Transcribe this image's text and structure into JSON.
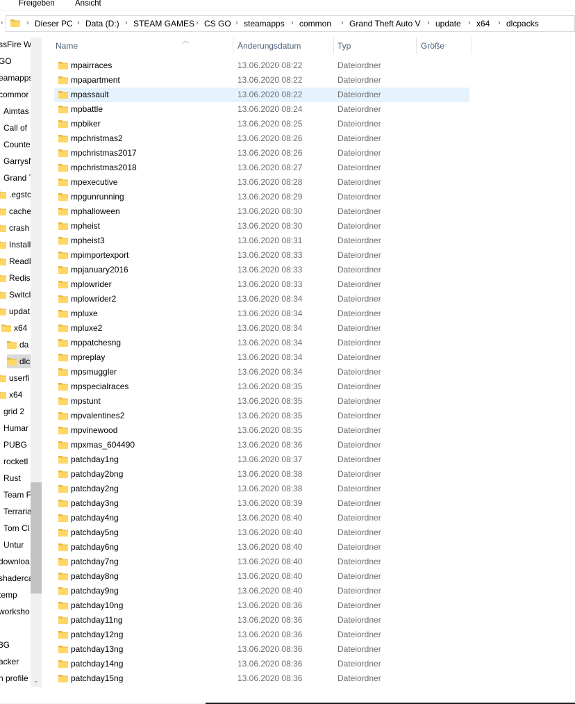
{
  "ribbon": {
    "tabs": [
      "Freigeben",
      "Ansicht"
    ]
  },
  "address_bar": {
    "icon": "folder-icon",
    "crumbs": [
      "Dieser PC",
      "Data (D:)",
      "STEAM GAMES",
      "CS GO",
      "steamapps",
      "common",
      "Grand Theft Auto V",
      "update",
      "x64",
      "dlcpacks"
    ]
  },
  "nav_pane": {
    "items": [
      {
        "label": "ssFire W",
        "folder": false
      },
      {
        "label": "GO",
        "folder": false
      },
      {
        "label": "eamapps",
        "folder": false
      },
      {
        "label": "commor",
        "folder": false
      },
      {
        "label": "Aimtas",
        "folder": false
      },
      {
        "label": "Call of",
        "folder": false
      },
      {
        "label": "Counte",
        "folder": false
      },
      {
        "label": "GarrysN",
        "folder": false
      },
      {
        "label": "Grand T",
        "folder": false
      },
      {
        "label": ".egstc",
        "folder": true
      },
      {
        "label": "cache",
        "folder": true
      },
      {
        "label": "crash",
        "folder": true
      },
      {
        "label": "Install",
        "folder": true
      },
      {
        "label": "ReadM",
        "folder": true
      },
      {
        "label": "Redist",
        "folder": true
      },
      {
        "label": "Switcl",
        "folder": true
      },
      {
        "label": "updat",
        "folder": true
      },
      {
        "label": "x64",
        "folder": true
      },
      {
        "label": "da",
        "folder": true
      },
      {
        "label": "dlc",
        "folder": true,
        "selected": true
      },
      {
        "label": "userfi",
        "folder": true
      },
      {
        "label": "x64",
        "folder": true
      },
      {
        "label": "grid 2",
        "folder": false
      },
      {
        "label": "Humar",
        "folder": false
      },
      {
        "label": "PUBG",
        "folder": false
      },
      {
        "label": "rocketl",
        "folder": false
      },
      {
        "label": "Rust",
        "folder": false
      },
      {
        "label": "Team F",
        "folder": false
      },
      {
        "label": "Terraria",
        "folder": false
      },
      {
        "label": "Tom Cl",
        "folder": false
      },
      {
        "label": "Untur",
        "folder": false
      },
      {
        "label": "downloa",
        "folder": false
      },
      {
        "label": "shaderca",
        "folder": false
      },
      {
        "label": "temp",
        "folder": false
      },
      {
        "label": "worksho",
        "folder": false
      },
      {
        "label": "",
        "folder": false
      },
      {
        "label": "3G",
        "folder": false
      },
      {
        "label": "acker",
        "folder": false
      },
      {
        "label": "n profile",
        "folder": false
      }
    ]
  },
  "columns": {
    "name": "Name",
    "date": "Änderungsdatum",
    "type": "Typ",
    "size": "Größe"
  },
  "files": [
    {
      "name": "mpairraces",
      "date": "13.06.2020 08:22",
      "type": "Dateiordner"
    },
    {
      "name": "mpapartment",
      "date": "13.06.2020 08:22",
      "type": "Dateiordner"
    },
    {
      "name": "mpassault",
      "date": "13.06.2020 08:22",
      "type": "Dateiordner",
      "hover": true
    },
    {
      "name": "mpbattle",
      "date": "13.06.2020 08:24",
      "type": "Dateiordner"
    },
    {
      "name": "mpbiker",
      "date": "13.06.2020 08:25",
      "type": "Dateiordner"
    },
    {
      "name": "mpchristmas2",
      "date": "13.06.2020 08:26",
      "type": "Dateiordner"
    },
    {
      "name": "mpchristmas2017",
      "date": "13.06.2020 08:26",
      "type": "Dateiordner"
    },
    {
      "name": "mpchristmas2018",
      "date": "13.06.2020 08:27",
      "type": "Dateiordner"
    },
    {
      "name": "mpexecutive",
      "date": "13.06.2020 08:28",
      "type": "Dateiordner"
    },
    {
      "name": "mpgunrunning",
      "date": "13.06.2020 08:29",
      "type": "Dateiordner"
    },
    {
      "name": "mphalloween",
      "date": "13.06.2020 08:30",
      "type": "Dateiordner"
    },
    {
      "name": "mpheist",
      "date": "13.06.2020 08:30",
      "type": "Dateiordner"
    },
    {
      "name": "mpheist3",
      "date": "13.06.2020 08:31",
      "type": "Dateiordner"
    },
    {
      "name": "mpimportexport",
      "date": "13.06.2020 08:33",
      "type": "Dateiordner"
    },
    {
      "name": "mpjanuary2016",
      "date": "13.06.2020 08:33",
      "type": "Dateiordner"
    },
    {
      "name": "mplowrider",
      "date": "13.06.2020 08:33",
      "type": "Dateiordner"
    },
    {
      "name": "mplowrider2",
      "date": "13.06.2020 08:34",
      "type": "Dateiordner"
    },
    {
      "name": "mpluxe",
      "date": "13.06.2020 08:34",
      "type": "Dateiordner"
    },
    {
      "name": "mpluxe2",
      "date": "13.06.2020 08:34",
      "type": "Dateiordner"
    },
    {
      "name": "mppatchesng",
      "date": "13.06.2020 08:34",
      "type": "Dateiordner"
    },
    {
      "name": "mpreplay",
      "date": "13.06.2020 08:34",
      "type": "Dateiordner"
    },
    {
      "name": "mpsmuggler",
      "date": "13.06.2020 08:34",
      "type": "Dateiordner"
    },
    {
      "name": "mpspecialraces",
      "date": "13.06.2020 08:35",
      "type": "Dateiordner"
    },
    {
      "name": "mpstunt",
      "date": "13.06.2020 08:35",
      "type": "Dateiordner"
    },
    {
      "name": "mpvalentines2",
      "date": "13.06.2020 08:35",
      "type": "Dateiordner"
    },
    {
      "name": "mpvinewood",
      "date": "13.06.2020 08:35",
      "type": "Dateiordner"
    },
    {
      "name": "mpxmas_604490",
      "date": "13.06.2020 08:36",
      "type": "Dateiordner"
    },
    {
      "name": "patchday1ng",
      "date": "13.06.2020 08:37",
      "type": "Dateiordner"
    },
    {
      "name": "patchday2bng",
      "date": "13.06.2020 08:38",
      "type": "Dateiordner"
    },
    {
      "name": "patchday2ng",
      "date": "13.06.2020 08:38",
      "type": "Dateiordner"
    },
    {
      "name": "patchday3ng",
      "date": "13.06.2020 08:39",
      "type": "Dateiordner"
    },
    {
      "name": "patchday4ng",
      "date": "13.06.2020 08:40",
      "type": "Dateiordner"
    },
    {
      "name": "patchday5ng",
      "date": "13.06.2020 08:40",
      "type": "Dateiordner"
    },
    {
      "name": "patchday6ng",
      "date": "13.06.2020 08:40",
      "type": "Dateiordner"
    },
    {
      "name": "patchday7ng",
      "date": "13.06.2020 08:40",
      "type": "Dateiordner"
    },
    {
      "name": "patchday8ng",
      "date": "13.06.2020 08:40",
      "type": "Dateiordner"
    },
    {
      "name": "patchday9ng",
      "date": "13.06.2020 08:40",
      "type": "Dateiordner"
    },
    {
      "name": "patchday10ng",
      "date": "13.06.2020 08:36",
      "type": "Dateiordner"
    },
    {
      "name": "patchday11ng",
      "date": "13.06.2020 08:36",
      "type": "Dateiordner"
    },
    {
      "name": "patchday12ng",
      "date": "13.06.2020 08:36",
      "type": "Dateiordner"
    },
    {
      "name": "patchday13ng",
      "date": "13.06.2020 08:36",
      "type": "Dateiordner"
    },
    {
      "name": "patchday14ng",
      "date": "13.06.2020 08:36",
      "type": "Dateiordner"
    },
    {
      "name": "patchday15ng",
      "date": "13.06.2020 08:36",
      "type": "Dateiordner"
    }
  ],
  "colors": {
    "folder_fill": "#ffd766",
    "folder_back": "#e8b63c",
    "hover_row": "#e5f3ff",
    "header_text": "#4c607a",
    "meta_text": "#6d6d6d"
  }
}
